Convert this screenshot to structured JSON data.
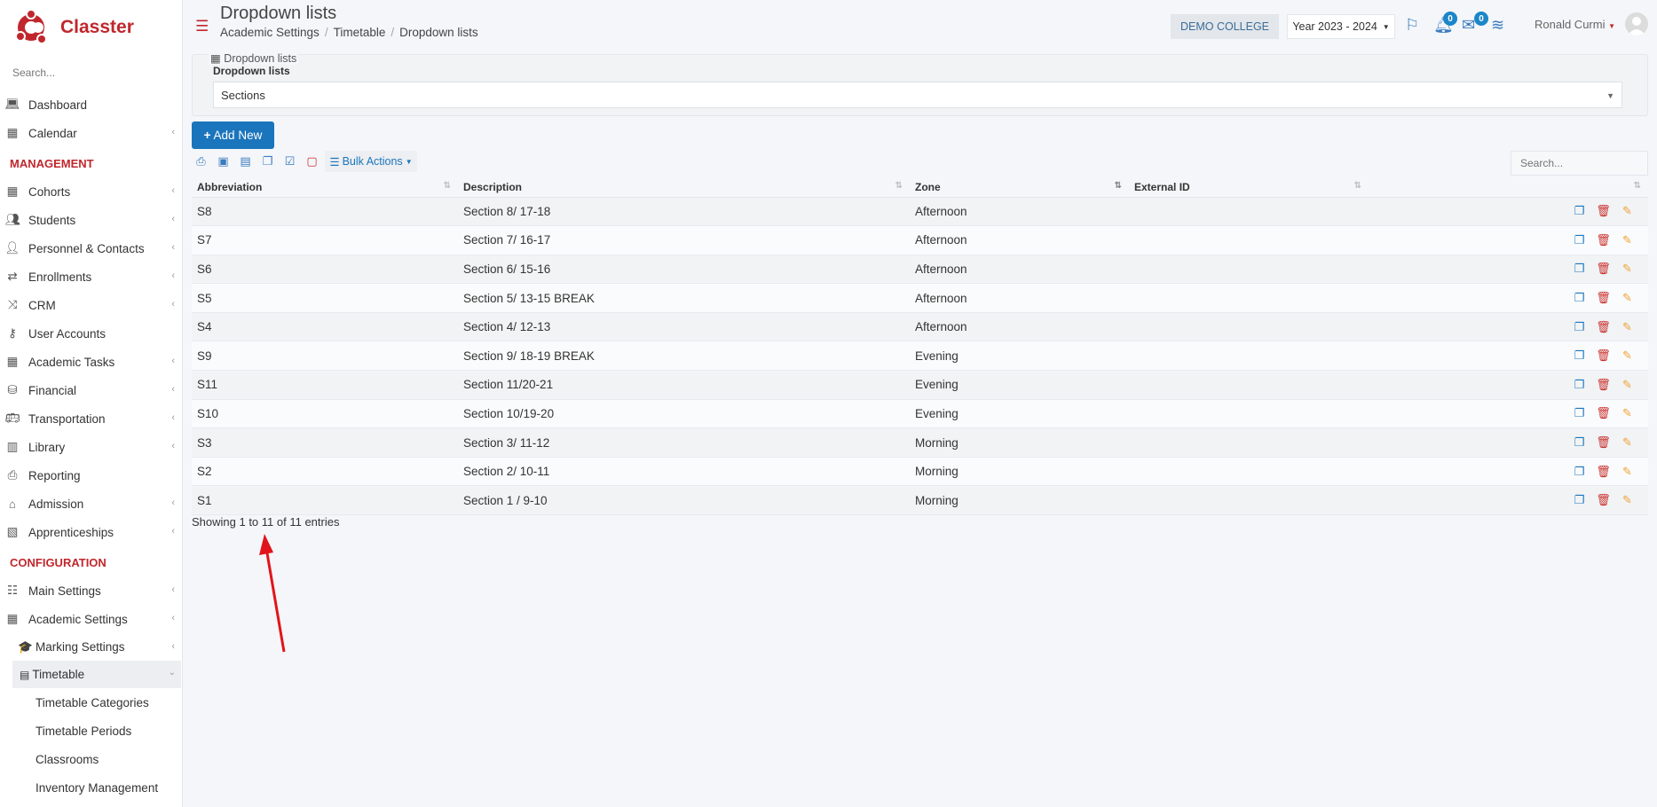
{
  "app": {
    "name": "Classter"
  },
  "sidebar": {
    "search_placeholder": "Search...",
    "items_top": [
      {
        "label": "Dashboard",
        "icon": "laptop-icon",
        "chevron": false
      },
      {
        "label": "Calendar",
        "icon": "calendar-icon",
        "chevron": true
      }
    ],
    "management_title": "MANAGEMENT",
    "management_items": [
      {
        "label": "Cohorts",
        "icon": "cohorts-icon",
        "chevron": true
      },
      {
        "label": "Students",
        "icon": "students-icon",
        "chevron": true
      },
      {
        "label": "Personnel & Contacts",
        "icon": "person-icon",
        "chevron": true
      },
      {
        "label": "Enrollments",
        "icon": "arrows-icon",
        "chevron": true
      },
      {
        "label": "CRM",
        "icon": "shuffle-icon",
        "chevron": true
      },
      {
        "label": "User Accounts",
        "icon": "key-icon",
        "chevron": false
      },
      {
        "label": "Academic Tasks",
        "icon": "grid-icon",
        "chevron": true
      },
      {
        "label": "Financial",
        "icon": "coins-icon",
        "chevron": true
      },
      {
        "label": "Transportation",
        "icon": "bus-icon",
        "chevron": true
      },
      {
        "label": "Library",
        "icon": "books-icon",
        "chevron": true
      },
      {
        "label": "Reporting",
        "icon": "printer-icon",
        "chevron": false
      },
      {
        "label": "Admission",
        "icon": "bank-icon",
        "chevron": true
      },
      {
        "label": "Apprenticeships",
        "icon": "box-icon",
        "chevron": true
      }
    ],
    "configuration_title": "CONFIGURATION",
    "config_items": [
      {
        "label": "Main Settings",
        "icon": "sliders-icon",
        "chevron": true
      },
      {
        "label": "Academic Settings",
        "icon": "cohorts-icon",
        "chevron": true
      }
    ],
    "marking_settings": "Marking Settings",
    "timetable": "Timetable",
    "timetable_children": [
      "Timetable Categories",
      "Timetable Periods",
      "Classrooms",
      "Inventory Management"
    ]
  },
  "header": {
    "title": "Dropdown lists",
    "breadcrumbs": [
      "Academic Settings",
      "Timetable",
      "Dropdown lists"
    ],
    "college": "DEMO COLLEGE",
    "year": "Year 2023 - 2024",
    "notifications_count": "0",
    "messages_count": "0",
    "user": "Ronald Curmi"
  },
  "panel": {
    "legend": "Dropdown lists",
    "label": "Dropdown lists",
    "selected": "Sections"
  },
  "toolbar": {
    "add_new": "Add New",
    "bulk_actions": "Bulk Actions",
    "search_placeholder": "Search..."
  },
  "table": {
    "columns": [
      "Abbreviation",
      "Description",
      "Zone",
      "External ID"
    ],
    "rows": [
      [
        "S8",
        "Section 8/ 17-18",
        "Afternoon",
        ""
      ],
      [
        "S7",
        "Section 7/ 16-17",
        "Afternoon",
        ""
      ],
      [
        "S6",
        "Section 6/ 15-16",
        "Afternoon",
        ""
      ],
      [
        "S5",
        "Section 5/ 13-15 BREAK",
        "Afternoon",
        ""
      ],
      [
        "S4",
        "Section 4/ 12-13",
        "Afternoon",
        ""
      ],
      [
        "S9",
        "Section 9/ 18-19 BREAK",
        "Evening",
        ""
      ],
      [
        "S11",
        "Section 11/20-21",
        "Evening",
        ""
      ],
      [
        "S10",
        "Section 10/19-20",
        "Evening",
        ""
      ],
      [
        "S3",
        "Section 3/ 11-12",
        "Morning",
        ""
      ],
      [
        "S2",
        "Section 2/ 10-11",
        "Morning",
        ""
      ],
      [
        "S1",
        "Section 1 / 9-10",
        "Morning",
        ""
      ]
    ],
    "info": "Showing 1 to 11 of 11 entries"
  },
  "colors": {
    "brand": "#c0272d",
    "primary": "#1b75bc",
    "danger": "#c9302c",
    "warning": "#f0a030"
  }
}
